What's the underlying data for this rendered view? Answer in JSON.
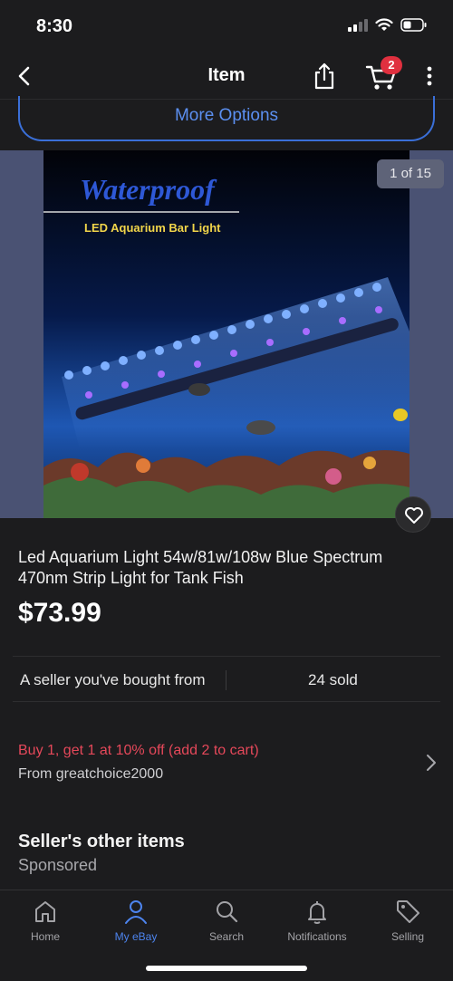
{
  "status": {
    "time": "8:30"
  },
  "nav": {
    "title": "Item",
    "cart_count": "2"
  },
  "more_options": {
    "label": "More Options"
  },
  "gallery": {
    "counter": "1 of 15",
    "image_heading": "Waterproof",
    "image_subheading": "LED Aquarium Bar Light"
  },
  "product": {
    "title": "Led Aquarium Light 54w/81w/108w Blue Spectrum 470nm Strip Light for Tank Fish",
    "price": "$73.99"
  },
  "seller": {
    "note": "A seller you've bought from",
    "sold": "24 sold"
  },
  "promo": {
    "title": "Buy 1, get 1 at 10% off (add 2 to cart)",
    "from": "From greatchoice2000"
  },
  "section": {
    "title": "Seller's other items",
    "subtitle": "Sponsored"
  },
  "tabs": [
    {
      "label": "Home",
      "icon": "home-icon"
    },
    {
      "label": "My eBay",
      "icon": "person-icon",
      "active": true
    },
    {
      "label": "Search",
      "icon": "search-icon"
    },
    {
      "label": "Notifications",
      "icon": "bell-icon"
    },
    {
      "label": "Selling",
      "icon": "tag-icon"
    }
  ],
  "colors": {
    "accent": "#4d84ee",
    "promo": "#e5485a",
    "badge": "#e0303f",
    "background": "#1c1c1e"
  }
}
